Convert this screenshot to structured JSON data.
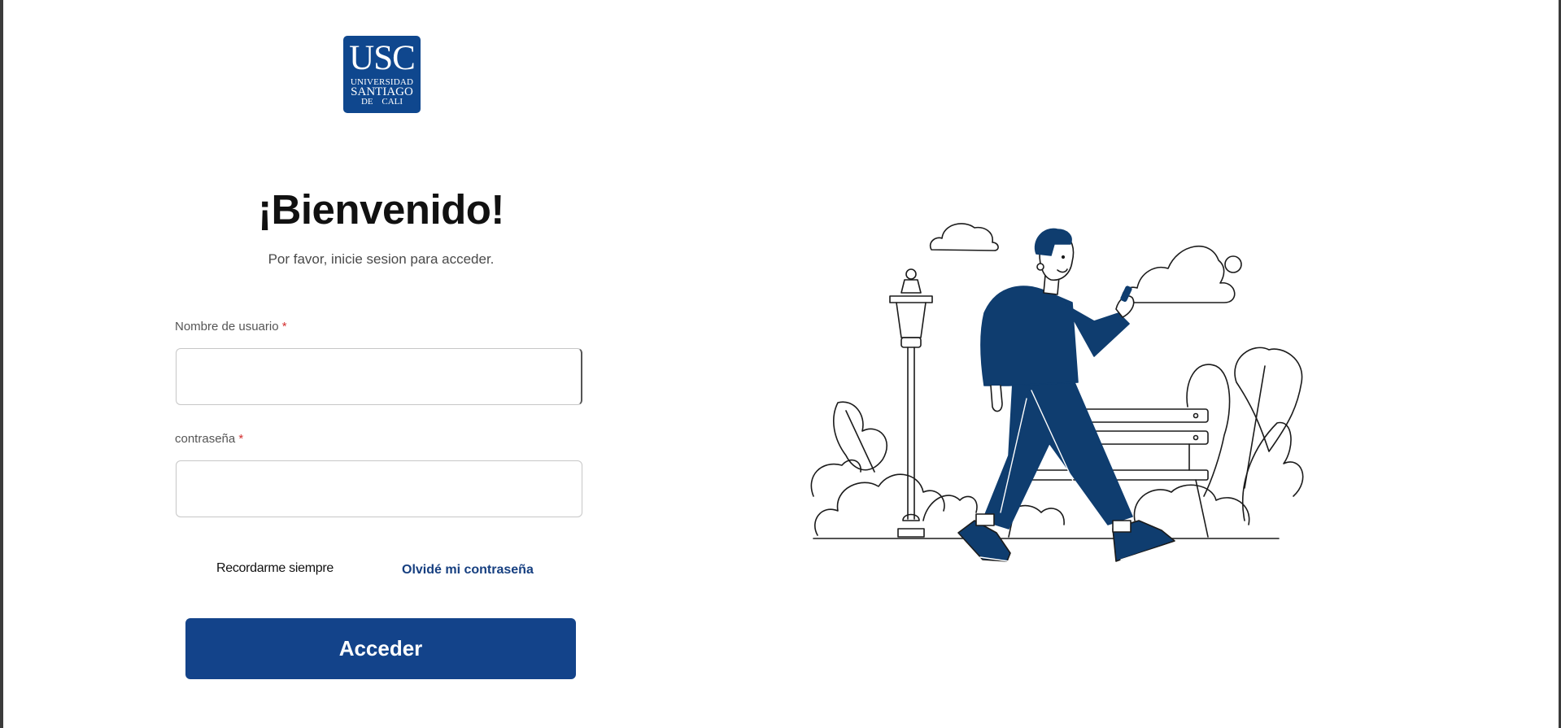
{
  "logo": {
    "main": "USC",
    "line1": "UNIVERSIDAD",
    "line2": "SANTIAGO",
    "line3": "DE CALI"
  },
  "header": {
    "title": "¡Bienvenido!",
    "subtitle": "Por favor, inicie sesion para acceder."
  },
  "form": {
    "username_label": "Nombre de usuario",
    "password_label": "contraseña",
    "required_mark": "*",
    "username_value": "",
    "password_value": "",
    "remember_label": "Recordarme siempre",
    "forgot_label": "Olvidé mi contraseña",
    "submit_label": "Acceder"
  },
  "colors": {
    "brand": "#0f478e",
    "button": "#13438a",
    "link": "#163f80",
    "required": "#d32f2f"
  },
  "illustration": {
    "icons": [
      "cloud-icon",
      "street-lamp-icon",
      "person-walking-icon",
      "park-bench-icon",
      "bush-icon"
    ]
  }
}
